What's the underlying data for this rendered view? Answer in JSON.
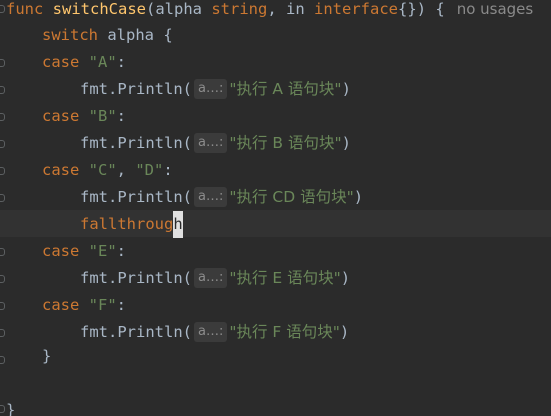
{
  "editor": {
    "colors": {
      "background": "#2b2b2b",
      "keyword": "#cc7832",
      "function": "#ffc66d",
      "string": "#6a8759",
      "text": "#a9b7c6",
      "hint": "#8c8c8c"
    },
    "header": {
      "kw_func": "func",
      "fn_name": "switchCase",
      "open_paren": "(",
      "param1": "alpha ",
      "param1_type": "string",
      "comma": ", ",
      "param2": "in ",
      "param2_type": "interface",
      "braces": "{}",
      "close": ") {",
      "usages": "no usages"
    },
    "switch_line": {
      "kw": "switch",
      "rest": " alpha {"
    },
    "param_hint": "a…:",
    "cases": [
      {
        "kw": "case",
        "values": "\"A\"",
        "colon": ":",
        "call": "fmt.Println(",
        "arg": "\"执行 A 语句块\"",
        "end": ")"
      },
      {
        "kw": "case",
        "values": "\"B\"",
        "colon": ":",
        "call": "fmt.Println(",
        "arg": "\"执行 B 语句块\"",
        "end": ")"
      },
      {
        "kw": "case",
        "values_a": "\"C\"",
        "sep": ", ",
        "values_b": "\"D\"",
        "colon": ":",
        "call": "fmt.Println(",
        "arg": "\"执行 CD 语句块\"",
        "end": ")",
        "fallthrough_a": "fallthroug",
        "fallthrough_b": "h"
      },
      {
        "kw": "case",
        "values": "\"E\"",
        "colon": ":",
        "call": "fmt.Println(",
        "arg": "\"执行 E 语句块\"",
        "end": ")"
      },
      {
        "kw": "case",
        "values": "\"F\"",
        "colon": ":",
        "call": "fmt.Println(",
        "arg": "\"执行 F 语句块\"",
        "end": ")"
      }
    ],
    "close_switch": "}",
    "close_func": "}"
  }
}
